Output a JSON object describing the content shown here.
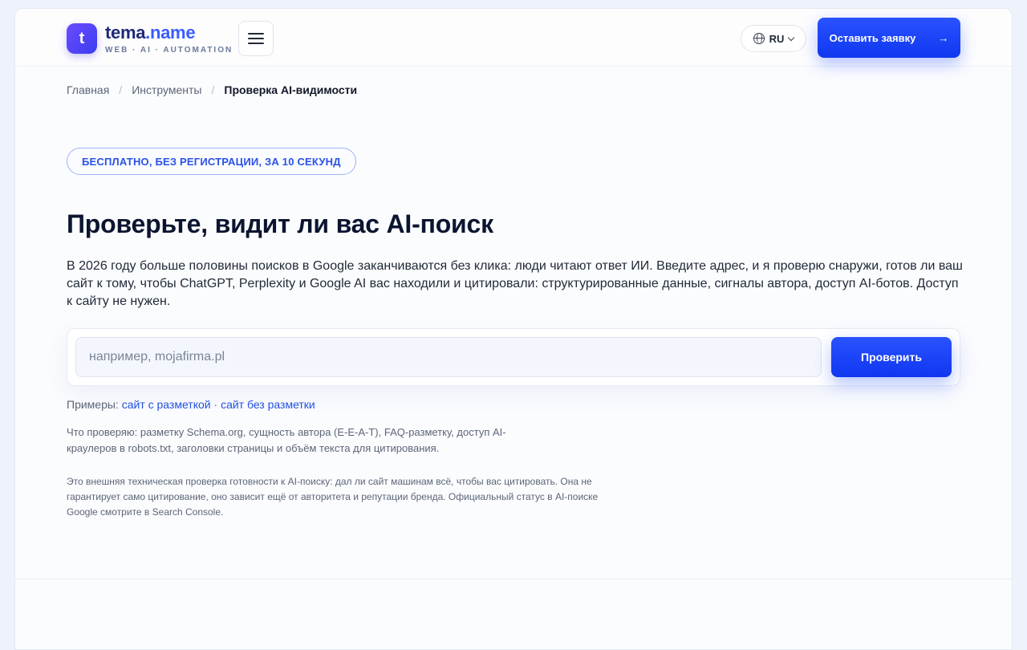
{
  "header": {
    "logo_letter": "t",
    "brand_main": "tema",
    "brand_accent": ".name",
    "brand_tagline": "WEB · AI · AUTOMATION",
    "lang": "RU",
    "cta_label": "Оставить заявку",
    "cta_arrow": "→"
  },
  "breadcrumb": {
    "items": [
      "Главная",
      "Инструменты"
    ],
    "separator": "/",
    "current": "Проверка AI-видимости"
  },
  "hero": {
    "badge": "БЕСПЛАТНО, БЕЗ РЕГИСТРАЦИИ, ЗА 10 СЕКУНД",
    "title": "Проверьте, видит ли вас AI-поиск",
    "intro": "В 2026 году больше половины поисков в Google заканчиваются без клика: люди читают ответ ИИ. Введите адрес, и я проверю снаружи, готов ли ваш сайт к тому, чтобы ChatGPT, Perplexity и Google AI вас находили и цитировали: структурированные данные, сигналы автора, доступ AI-ботов. Доступ к сайту не нужен."
  },
  "search": {
    "placeholder": "например, mojafirma.pl",
    "value": "",
    "button_label": "Проверить"
  },
  "examples": {
    "label": "Примеры: ",
    "link1": "сайт с разметкой",
    "separator": " · ",
    "link2": "сайт без разметки"
  },
  "checks_text": "Что проверяю: разметку Schema.org, сущность автора (E-E-A-T), FAQ-разметку, доступ AI-краулеров в robots.txt, заголовки страницы и объём текста для цитирования.",
  "disclaimer": "Это внешняя техническая проверка готовности к AI-поиску: дал ли сайт машинам всё, чтобы вас цитировать. Она не гарантирует само цитирование, оно зависит ещё от авторитета и репутации бренда. Официальный статус в AI-поиске Google смотрите в Search Console.",
  "colors": {
    "accent": "#1f45ff",
    "link": "#2150e0",
    "badge_text": "#2a51e8"
  }
}
